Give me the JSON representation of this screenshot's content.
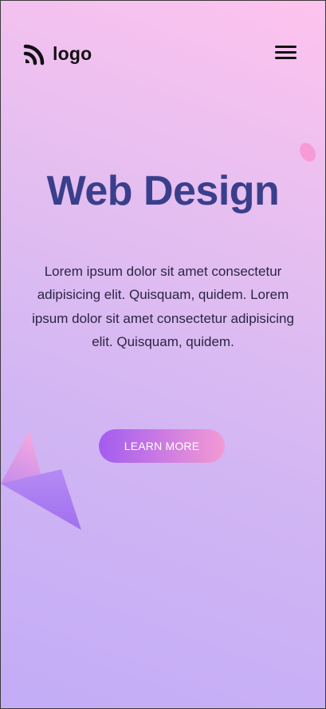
{
  "header": {
    "logo_icon": "rss-arcs-logo-icon",
    "logo_text": "logo",
    "menu_icon": "hamburger-menu-icon"
  },
  "hero": {
    "title": "Web Design",
    "description": "Lorem ipsum dolor sit amet consectetur adipisicing elit. Quisquam, quidem. Lorem ipsum dolor sit amet consectetur adipisicing elit. Quisquam, quidem.",
    "cta_label": "LEARN MORE"
  },
  "colors": {
    "title": "#3a3f8c",
    "cta_gradient_start": "#a35cf0",
    "cta_gradient_end": "#f39ad3",
    "background_top": "#fec3ee",
    "background_bottom": "#c3acf7"
  }
}
